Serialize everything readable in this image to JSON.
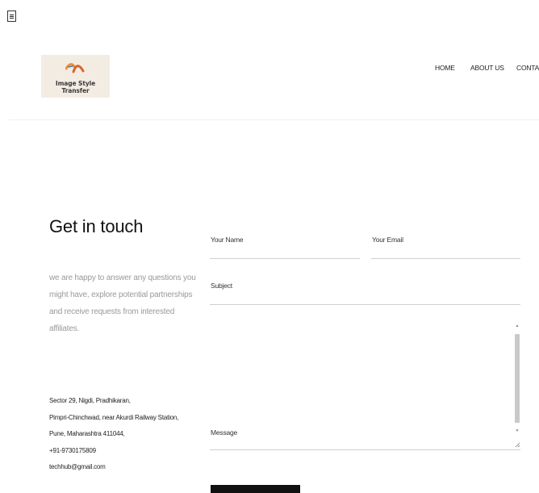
{
  "header": {
    "logo_text": "Image Style Transfer",
    "nav": [
      {
        "label": "HOME"
      },
      {
        "label": "ABOUT US"
      },
      {
        "label": "CONTAC"
      }
    ]
  },
  "contact": {
    "title": "Get in touch",
    "intro_lines": [
      "we are happy to answer any questions you",
      "might have, explore potential partnerships",
      "and receive requests from interested",
      "affiliates."
    ],
    "address_lines": [
      "Sector 29, Nigdi, Pradhikaran,",
      "Pimpri-Chinchwad, near Akurdi Railway Station,",
      "Pune, Maharashtra 411044,",
      "+91-9730175809",
      "techhub@gmail.com"
    ]
  },
  "form": {
    "name_label": "Your Name",
    "email_label": "Your Email",
    "subject_label": "Subject",
    "message_label": "Message",
    "name_value": "",
    "email_value": "",
    "subject_value": "",
    "message_value": ""
  },
  "colors": {
    "logo_bg": "#f3ece3",
    "logo_mark": "#e8913a",
    "button_bg": "#111111"
  }
}
